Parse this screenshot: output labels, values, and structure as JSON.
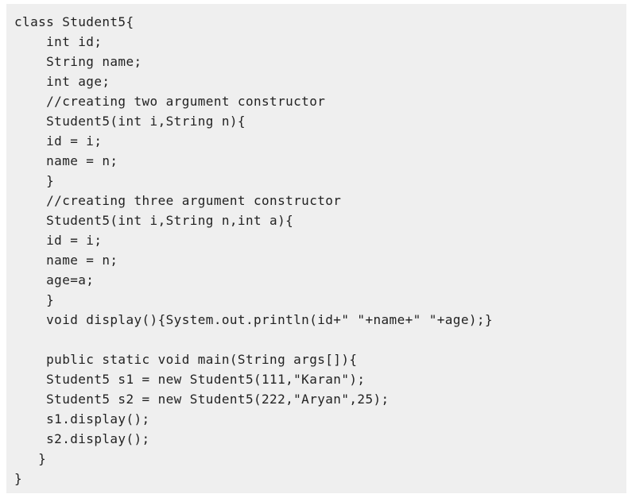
{
  "code": {
    "lines": [
      "class Student5{",
      "    int id;",
      "    String name;",
      "    int age;",
      "    //creating two argument constructor",
      "    Student5(int i,String n){",
      "    id = i;",
      "    name = n;",
      "    }",
      "    //creating three argument constructor",
      "    Student5(int i,String n,int a){",
      "    id = i;",
      "    name = n;",
      "    age=a;",
      "    }",
      "    void display(){System.out.println(id+\" \"+name+\" \"+age);}",
      "",
      "    public static void main(String args[]){",
      "    Student5 s1 = new Student5(111,\"Karan\");",
      "    Student5 s2 = new Student5(222,\"Aryan\",25);",
      "    s1.display();",
      "    s2.display();",
      "   }",
      "}"
    ]
  }
}
